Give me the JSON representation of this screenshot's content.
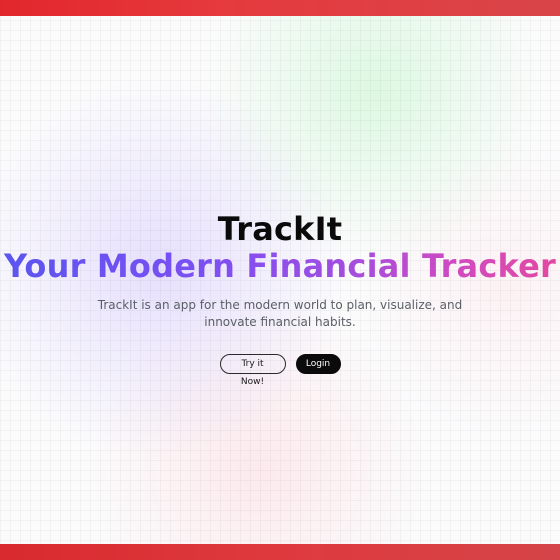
{
  "hero": {
    "brand": "TrackIt",
    "tagline": "Your Modern Financial Tracker",
    "description": "TrackIt is an app for the modern world to plan, visualize, and innovate financial habits."
  },
  "actions": {
    "try_label": "Try it Now!",
    "login_label": "Login"
  },
  "colors": {
    "accent_bar": "#e2272c",
    "tagline_gradient": [
      "#5b55f0",
      "#a34de0",
      "#e2499f"
    ],
    "primary_button": "#0b0b0b"
  }
}
